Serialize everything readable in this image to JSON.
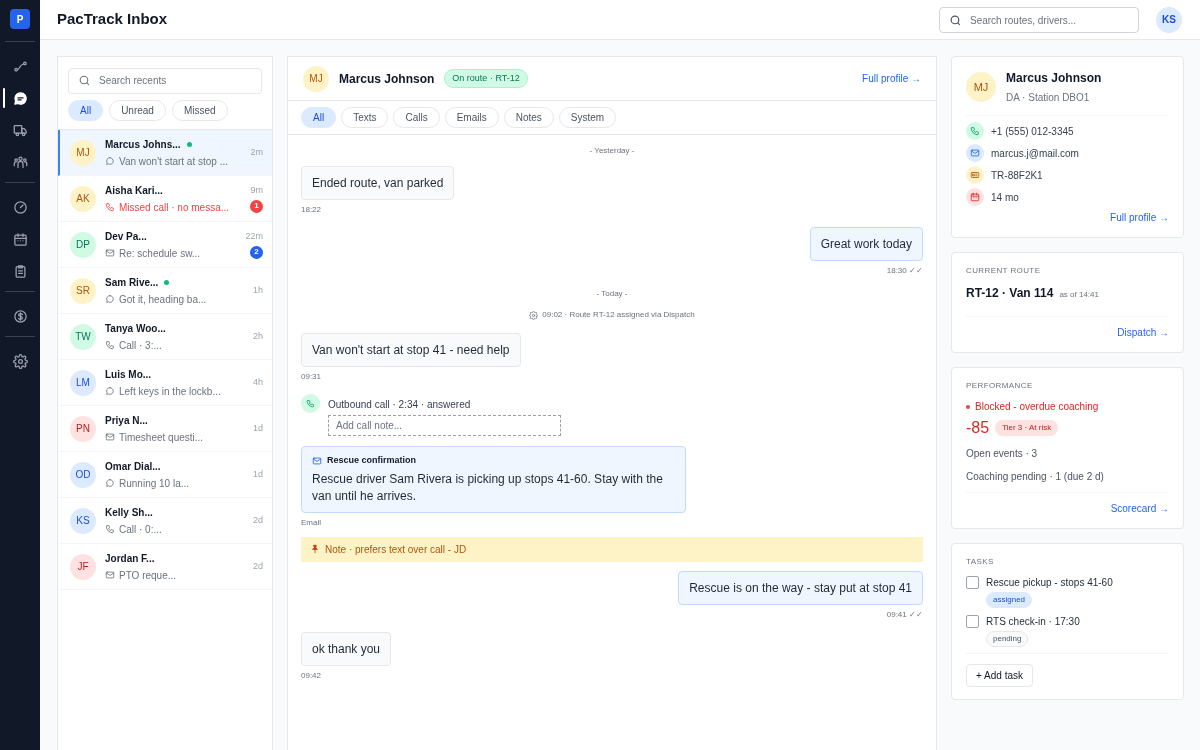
{
  "app": {
    "logo": "P",
    "title": "PacTrack Inbox",
    "search_placeholder": "Search routes, drivers...",
    "user_initials": "KS"
  },
  "nav": [
    {
      "selected": false
    },
    {
      "selected": true
    },
    {
      "selected": false
    },
    {
      "selected": false
    },
    {
      "selected": false
    },
    {
      "selected": false
    },
    {
      "selected": false
    },
    {
      "selected": false
    },
    {
      "selected": false
    }
  ],
  "recents": {
    "search_placeholder": "Search recents",
    "filters": [
      {
        "label": "All",
        "selected": true
      },
      {
        "label": "Unread",
        "selected": false
      },
      {
        "label": "Missed",
        "selected": false
      }
    ],
    "items": [
      {
        "initials": "MJ",
        "color": "#fef3c7",
        "name": "Marcus Johns...",
        "online": true,
        "kind": "text",
        "preview": "Van won't start at stop ...",
        "missed": false,
        "time": "2m",
        "selected": true
      },
      {
        "initials": "AK",
        "color": "#fef3c7",
        "name": "Aisha Kari...",
        "online": false,
        "kind": "call",
        "preview": "Missed call · no messa...",
        "missed": true,
        "time": "9m",
        "badge": "1",
        "selected": false
      },
      {
        "initials": "DP",
        "color": "#d1fae5",
        "name": "Dev Pa...",
        "online": false,
        "kind": "email",
        "preview": "Re: schedule sw...",
        "missed": false,
        "time": "22m",
        "badge": "2",
        "selected": false
      },
      {
        "initials": "SR",
        "color": "#fef3c7",
        "name": "Sam Rive...",
        "online": true,
        "kind": "text",
        "preview": "Got it, heading ba...",
        "missed": false,
        "time": "1h",
        "selected": false
      },
      {
        "initials": "TW",
        "color": "#d1fae5",
        "name": "Tanya Woo...",
        "online": false,
        "kind": "call",
        "preview": "Call · 3:...",
        "missed": false,
        "time": "2h",
        "selected": false
      },
      {
        "initials": "LM",
        "color": "#dbeafe",
        "name": "Luis Mo...",
        "online": false,
        "kind": "text",
        "preview": "Left keys in the lockb...",
        "missed": false,
        "time": "4h",
        "selected": false
      },
      {
        "initials": "PN",
        "color": "#fee2e2",
        "name": "Priya N...",
        "online": false,
        "kind": "email",
        "preview": "Timesheet questi...",
        "missed": false,
        "time": "1d",
        "selected": false
      },
      {
        "initials": "OD",
        "color": "#dbeafe",
        "name": "Omar Dial...",
        "online": false,
        "kind": "text",
        "preview": "Running 10 la...",
        "missed": false,
        "time": "1d",
        "selected": false
      },
      {
        "initials": "KS",
        "color": "#dbeafe",
        "name": "Kelly Sh...",
        "online": false,
        "kind": "call",
        "preview": "Call · 0:...",
        "missed": false,
        "time": "2d",
        "selected": false
      },
      {
        "initials": "JF",
        "color": "#fee2e2",
        "name": "Jordan F...",
        "online": false,
        "kind": "email",
        "preview": "PTO reque...",
        "missed": false,
        "time": "2d",
        "selected": false
      }
    ]
  },
  "conversation": {
    "initials": "MJ",
    "name": "Marcus Johnson",
    "status": "On route · RT-12",
    "link": "Full profile →",
    "filters": [
      {
        "label": "All",
        "selected": true
      },
      {
        "label": "Texts",
        "selected": false
      },
      {
        "label": "Calls",
        "selected": false
      },
      {
        "label": "Emails",
        "selected": false
      },
      {
        "label": "Notes",
        "selected": false
      },
      {
        "label": "System",
        "selected": false
      }
    ],
    "messages": [
      {
        "kind": "divider",
        "text": "- Yesterday -"
      },
      {
        "kind": "incoming",
        "text": "Ended route, van parked",
        "time": "18:22"
      },
      {
        "kind": "outgoing",
        "text": "Great work today",
        "time": "18:30 ✓✓"
      },
      {
        "kind": "divider",
        "text": "- Today -"
      },
      {
        "kind": "system",
        "text": "09:02 · Route RT-12 assigned via Dispatch"
      },
      {
        "kind": "incoming",
        "text": "Van won't start at stop 41 - need help",
        "time": "09:31"
      },
      {
        "kind": "call",
        "text": "Outbound call · 2:34 · answered",
        "placeholder": "Add call note..."
      },
      {
        "kind": "email",
        "title": "Rescue confirmation",
        "text": "Rescue driver Sam Rivera is picking up stops 41-60. Stay with the van until he arrives.",
        "time": "Email"
      },
      {
        "kind": "note",
        "text": "Note · prefers text over call - JD"
      },
      {
        "kind": "outgoing",
        "text": "Rescue is on the way - stay put at stop 41",
        "time": "09:41 ✓✓"
      },
      {
        "kind": "incoming",
        "text": "ok thank you",
        "time": "09:42"
      }
    ]
  },
  "profile": {
    "initials": "MJ",
    "name": "Marcus Johnson",
    "role": "DA · Station DBO1",
    "details": [
      {
        "kind": "phone",
        "text": "+1 (555) 012-3345"
      },
      {
        "kind": "mail",
        "text": "marcus.j@mail.com"
      },
      {
        "kind": "id",
        "text": "TR-88F2K1"
      },
      {
        "kind": "calendar",
        "text": "14 mo"
      }
    ],
    "link": "Full profile →"
  },
  "route": {
    "heading": "CURRENT ROUTE",
    "value": "RT-12 · Van 114",
    "as_of": "as of 14:41",
    "link": "Dispatch →"
  },
  "performance": {
    "heading": "PERFORMANCE",
    "alert": "Blocked - overdue coaching",
    "score": "-85",
    "tier": "Tier 3 · At risk",
    "stats": [
      "Open events · 3",
      "Coaching pending · 1 (due 2 d)"
    ],
    "link": "Scorecard →"
  },
  "tasks": {
    "heading": "TASKS",
    "items": [
      {
        "label": "Rescue pickup - stops 41-60",
        "status": "assigned",
        "kind": "assigned",
        "checked": false
      },
      {
        "label": "RTS check-in · 17:30",
        "status": "pending",
        "kind": "pending",
        "checked": false
      }
    ],
    "add": "+ Add task"
  }
}
